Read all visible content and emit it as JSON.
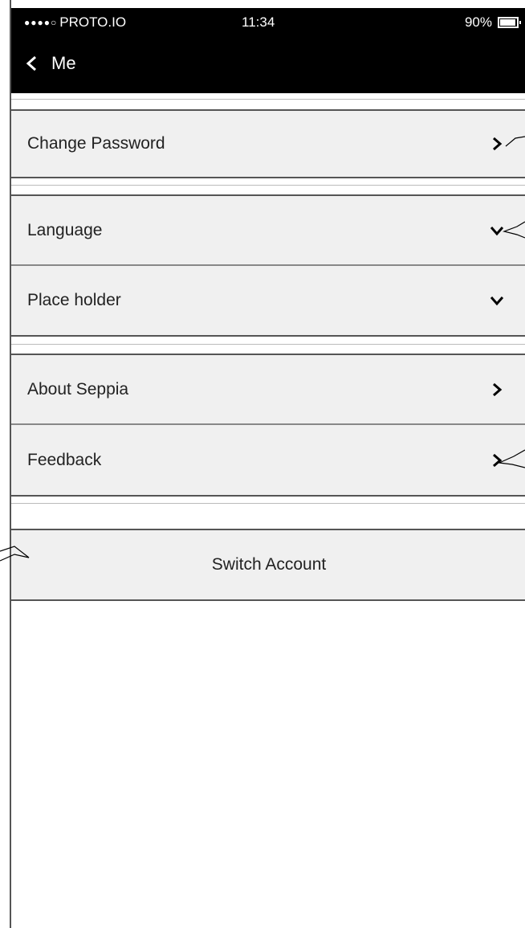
{
  "status_bar": {
    "carrier": "PROTO.IO",
    "signal_dots": "●●●●○",
    "time": "11:34",
    "battery": "90%"
  },
  "nav": {
    "back_label": "Me"
  },
  "settings": {
    "change_password": "Change Password",
    "language": "Language",
    "place_holder": "Place holder",
    "about": "About Seppia",
    "feedback": "Feedback",
    "switch_account": "Switch Account"
  },
  "colors": {
    "header_bg": "#000000",
    "row_bg": "#f0f0f0",
    "border": "#555555"
  }
}
